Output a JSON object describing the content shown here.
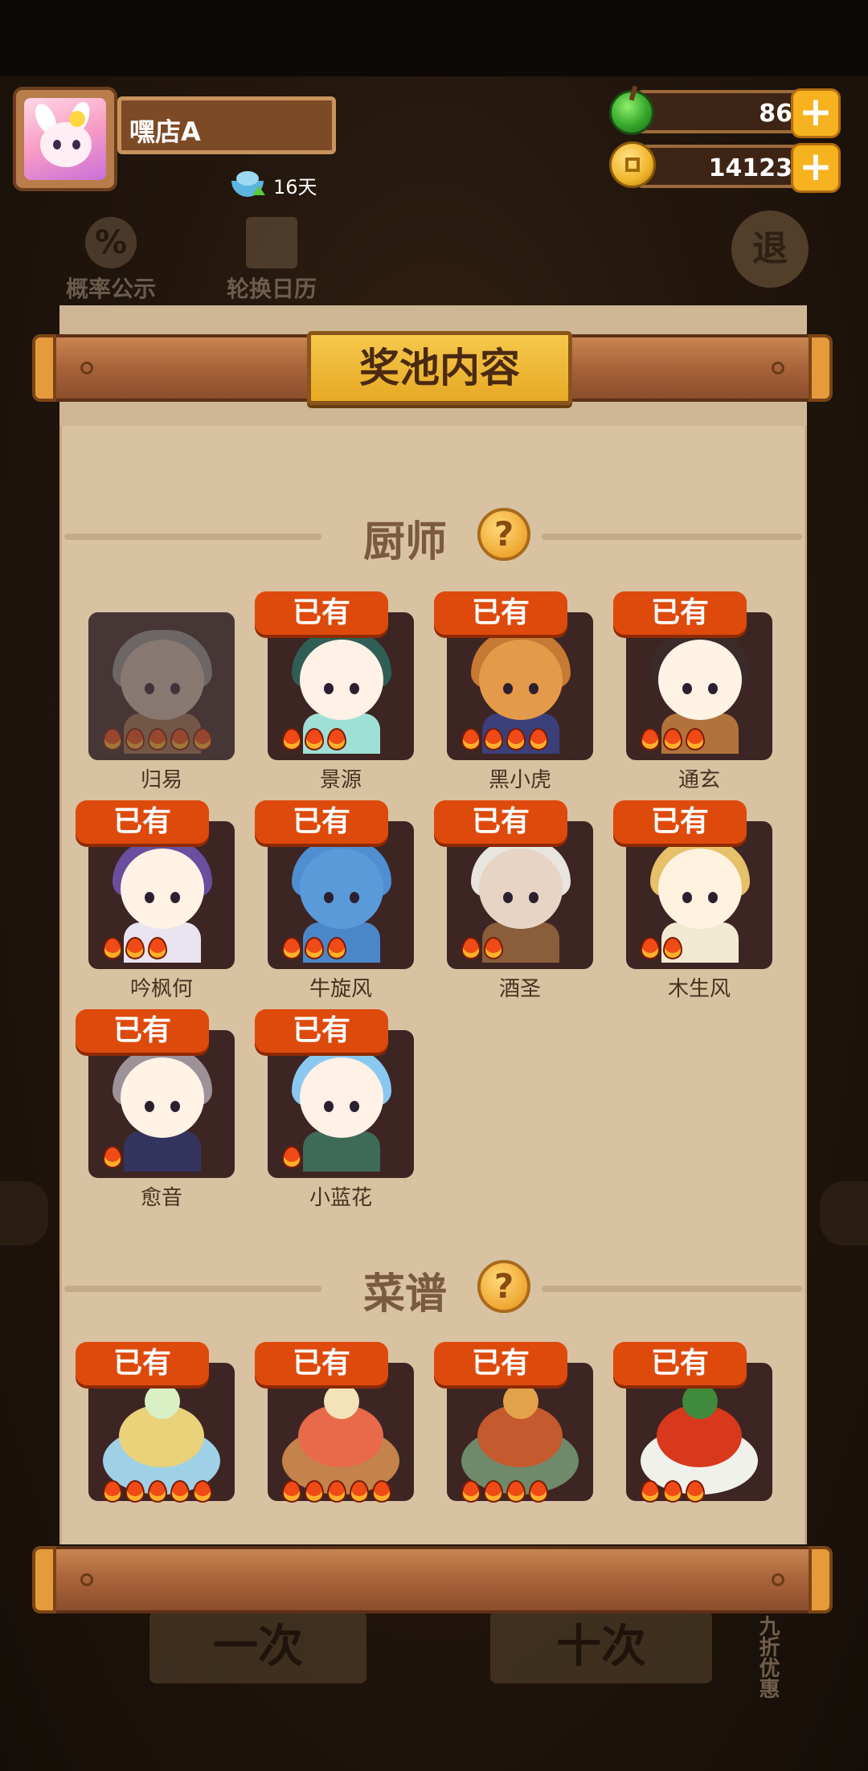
{
  "header": {
    "shop_name": "嘿店A",
    "days_label": "16天",
    "gems": "86",
    "coins": "14123",
    "plus_label": "+"
  },
  "background": {
    "probability_label": "概率公示",
    "probability_icon": "%",
    "calendar_label": "轮换日历",
    "exit_label": "退",
    "draw_one_label": "一次",
    "draw_ten_label": "十次",
    "discount_label": "九折优惠"
  },
  "modal": {
    "title": "奖池内容",
    "chefs_section": "厨师",
    "recipes_section": "菜谱",
    "help_glyph": "?",
    "owned_label": "已有"
  },
  "chefs": [
    {
      "name": "归易",
      "owned": false,
      "stars": 5,
      "hair": "#8e8e8e",
      "skin": "#c9b8a8",
      "body": "#9b6d4a"
    },
    {
      "name": "景源",
      "owned": true,
      "stars": 3,
      "hair": "#2f5e55",
      "skin": "#fff1e6",
      "body": "#9fe0d6"
    },
    {
      "name": "黑小虎",
      "owned": true,
      "stars": 4,
      "hair": "#c67a33",
      "skin": "#e59a4a",
      "body": "#3b3f7a"
    },
    {
      "name": "通玄",
      "owned": true,
      "stars": 3,
      "hair": "#3a2a2a",
      "skin": "#fff3e6",
      "body": "#b0733b"
    },
    {
      "name": "吟枫何",
      "owned": true,
      "stars": 3,
      "hair": "#6a4f9e",
      "skin": "#fff3e6",
      "body": "#e9e4ef"
    },
    {
      "name": "牛旋风",
      "owned": true,
      "stars": 3,
      "hair": "#4f8fd1",
      "skin": "#5b9ad9",
      "body": "#4a87c9"
    },
    {
      "name": "酒圣",
      "owned": true,
      "stars": 2,
      "hair": "#e8e4e0",
      "skin": "#e7d4c4",
      "body": "#8a5e3a"
    },
    {
      "name": "木生风",
      "owned": true,
      "stars": 2,
      "hair": "#e7c06a",
      "skin": "#fff3e0",
      "body": "#f2e9d2"
    },
    {
      "name": "愈音",
      "owned": true,
      "stars": 1,
      "hair": "#9c9298",
      "skin": "#fff3e6",
      "body": "#33355e"
    },
    {
      "name": "小蓝花",
      "owned": true,
      "stars": 1,
      "hair": "#8ac8f0",
      "skin": "#fff1e6",
      "body": "#3e6a58"
    }
  ],
  "recipes": [
    {
      "owned": true,
      "stars": 5,
      "plate": "#9fd1e6",
      "food": "#e9d27a",
      "top": "#d9f0c4"
    },
    {
      "owned": true,
      "stars": 5,
      "plate": "#c4834a",
      "food": "#e86a4a",
      "top": "#f4e2b8"
    },
    {
      "owned": true,
      "stars": 4,
      "plate": "#6e8a6a",
      "food": "#c45a2e",
      "top": "#e2a24a"
    },
    {
      "owned": true,
      "stars": 3,
      "plate": "#f1f1ec",
      "food": "#d8381c",
      "top": "#3f8a3c"
    }
  ]
}
